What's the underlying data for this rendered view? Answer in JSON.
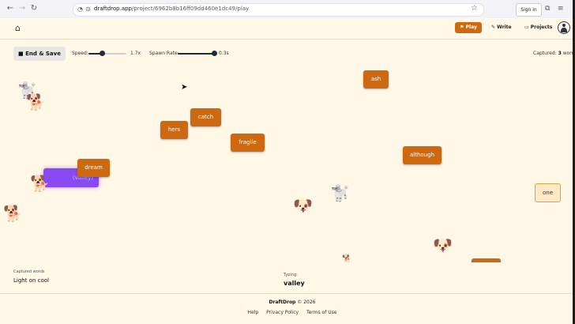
{
  "browser": {
    "url_lead": "draftdrop.app",
    "url_rest": "/project/6962b8b16ff09dd460e1dc49/play",
    "ext_label": "Sign in"
  },
  "header": {
    "play_label": "Play",
    "write_label": "Write",
    "projects_label": "Projects"
  },
  "controls": {
    "end_save_label": "End & Save",
    "speed_label": "Speed:",
    "speed_value": "1.7x",
    "speed_fraction": 0.35,
    "spawn_label": "Spawn Rate:",
    "spawn_value": "0.3s",
    "spawn_fraction": 0.95,
    "captured_prefix": "Captured:",
    "captured_count": "3",
    "captured_suffix": "words"
  },
  "words": {
    "ash": "ash",
    "catch": "catch",
    "hers": "hers",
    "fragile": "fragile",
    "although": "although",
    "dream": "dream",
    "one": "one",
    "target": "(valley)"
  },
  "bottom": {
    "captured_words_label": "Captured words",
    "captured_words_value": "Light on cool",
    "typing_label": "Typing:",
    "typing_value": "valley"
  },
  "footer": {
    "brand": "DraftDrop",
    "copyright": "© 2026",
    "links": [
      "Help",
      "Privacy Policy",
      "Terms of Use"
    ]
  },
  "icons": {
    "back": "back-arrow-icon",
    "forward": "forward-arrow-icon",
    "reload": "reload-icon",
    "home": "home-icon",
    "cursor": "mouse-cursor-icon",
    "dog": "dog-icon",
    "poodle": "poodle-icon"
  },
  "colors": {
    "word_bg": "#cd6a11",
    "target_bg": "#8a4af3",
    "page_bg": "#fff8e7"
  }
}
